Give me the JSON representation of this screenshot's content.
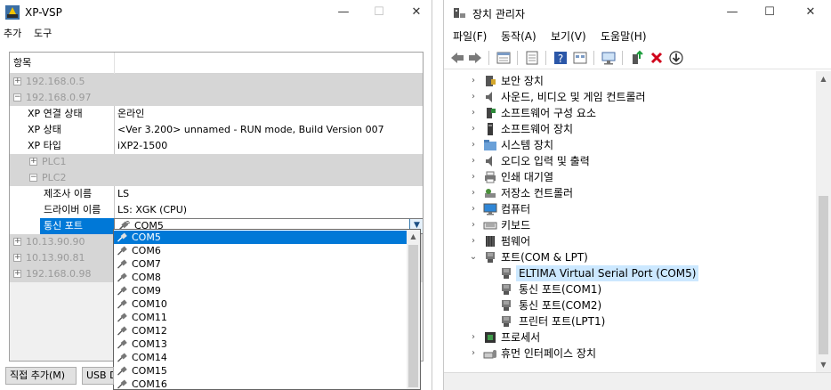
{
  "left_window": {
    "title": "XP-VSP",
    "menu": [
      "추가",
      "도구"
    ],
    "header": {
      "col1": "항목",
      "col2": ""
    },
    "rows": [
      {
        "label": "192.168.0.5",
        "value": ""
      },
      {
        "label": "192.168.0.97",
        "value": ""
      },
      {
        "label": "XP 연결 상태",
        "value": "온라인"
      },
      {
        "label": "XP 상태",
        "value": "<Ver 3.200> unnamed - RUN mode, Build Version 007"
      },
      {
        "label": "XP 타입",
        "value": "iXP2-1500"
      },
      {
        "label": "PLC1",
        "value": ""
      },
      {
        "label": "PLC2",
        "value": ""
      },
      {
        "label": "제조사 이름",
        "value": "LS"
      },
      {
        "label": "드라이버 이름",
        "value": "LS: XGK (CPU)"
      },
      {
        "label": "통신 포트",
        "value": "COM5"
      },
      {
        "label": "10.13.90.90",
        "value": ""
      },
      {
        "label": "10.13.90.81",
        "value": ""
      },
      {
        "label": "192.168.0.98",
        "value": ""
      }
    ],
    "dropdown_options": [
      "COM5",
      "COM6",
      "COM7",
      "COM8",
      "COM9",
      "COM10",
      "COM11",
      "COM12",
      "COM13",
      "COM14",
      "COM15",
      "COM16"
    ],
    "buttons": {
      "add_direct": "직접 추가(M)",
      "usb": "USB D"
    }
  },
  "right_window": {
    "title": "장치 관리자",
    "menu": [
      "파일(F)",
      "동작(A)",
      "보기(V)",
      "도움말(H)"
    ],
    "tree": [
      {
        "label": "보안 장치",
        "icon": "security-chip-icon"
      },
      {
        "label": "사운드, 비디오 및 게임 컨트롤러",
        "icon": "speaker-icon"
      },
      {
        "label": "소프트웨어 구성 요소",
        "icon": "software-component-icon"
      },
      {
        "label": "소프트웨어 장치",
        "icon": "software-device-icon"
      },
      {
        "label": "시스템 장치",
        "icon": "system-folder-icon"
      },
      {
        "label": "오디오 입력 및 출력",
        "icon": "speaker-icon"
      },
      {
        "label": "인쇄 대기열",
        "icon": "printer-icon"
      },
      {
        "label": "저장소 컨트롤러",
        "icon": "storage-controller-icon"
      },
      {
        "label": "컴퓨터",
        "icon": "monitor-icon"
      },
      {
        "label": "키보드",
        "icon": "keyboard-icon"
      },
      {
        "label": "펌웨어",
        "icon": "firmware-chip-icon"
      },
      {
        "label": "포트(COM & LPT)",
        "icon": "port-icon"
      },
      {
        "label": "ELTIMA Virtual Serial Port (COM5)",
        "icon": "port-icon"
      },
      {
        "label": "통신 포트(COM1)",
        "icon": "port-icon"
      },
      {
        "label": "통신 포트(COM2)",
        "icon": "port-icon"
      },
      {
        "label": "프린터 포트(LPT1)",
        "icon": "port-icon"
      },
      {
        "label": "프로세서",
        "icon": "processor-icon"
      },
      {
        "label": "휴먼 인터페이스 장치",
        "icon": "hid-icon"
      }
    ]
  }
}
